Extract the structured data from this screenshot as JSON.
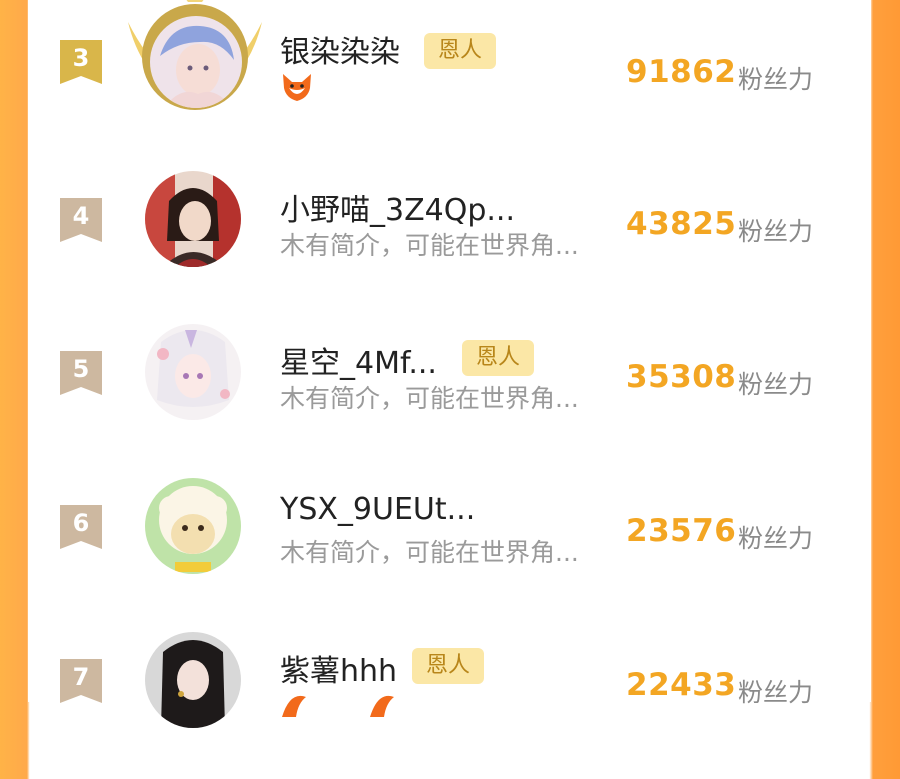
{
  "rows": [
    {
      "rank": "3",
      "name": "银染染染",
      "badge": "恩人",
      "bio": "",
      "score": "91862",
      "unit": "粉丝力",
      "rank_color": "#d9b64a"
    },
    {
      "rank": "4",
      "name": "小野喵_3Z4Qp...",
      "badge": "",
      "bio": "木有简介，可能在世界角...",
      "score": "43825",
      "unit": "粉丝力",
      "rank_color": "#cdb8a0"
    },
    {
      "rank": "5",
      "name": "星空_4Mf...",
      "badge": "恩人",
      "bio": "木有简介，可能在世界角...",
      "score": "35308",
      "unit": "粉丝力",
      "rank_color": "#cdb8a0"
    },
    {
      "rank": "6",
      "name": "YSX_9UEUt...",
      "badge": "",
      "bio": "木有简介，可能在世界角...",
      "score": "23576",
      "unit": "粉丝力",
      "rank_color": "#cdb8a0"
    },
    {
      "rank": "7",
      "name": "紫薯hhh",
      "badge": "恩人",
      "bio": "",
      "score": "22433",
      "unit": "粉丝力",
      "rank_color": "#cdb8a0"
    }
  ],
  "colors": {
    "score": "#f3a623",
    "badge_bg": "#fbe7a6",
    "badge_text": "#b8861a",
    "side": "#ffa94a"
  },
  "icons": {
    "fox": "fox-icon",
    "crown": "crown-icon"
  }
}
